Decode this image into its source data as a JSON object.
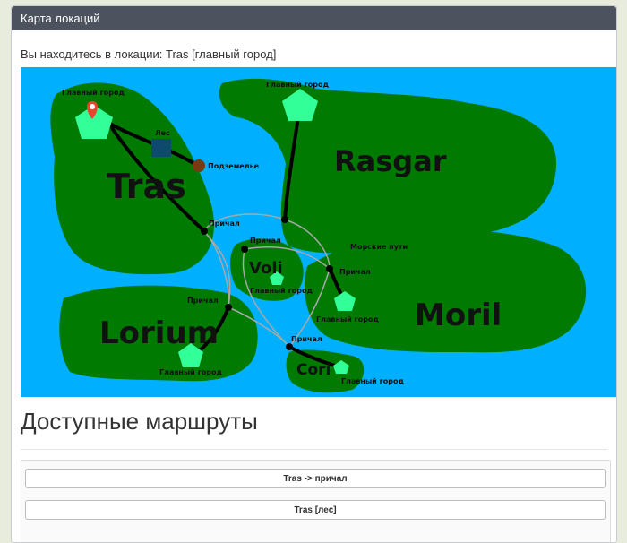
{
  "panel": {
    "title": "Карта локаций"
  },
  "location": {
    "current_text": "Вы находитесь в локации: Tras [главный город]"
  },
  "map": {
    "colors": {
      "sea": "#00b0ff",
      "land": "#007a00",
      "capital": "#33ff99",
      "forest": "#0e4a6e",
      "dungeon": "#7a3a10",
      "road": "#000000",
      "sea_route": "#a8a8a8"
    },
    "islands": [
      "Tras",
      "Rasgar",
      "Voli",
      "Moril",
      "Lorium",
      "Cori"
    ],
    "labels": {
      "capital_tras": "Главный город",
      "capital_rasgar": "Главный город",
      "capital_voli": "Главный город",
      "capital_moril": "Главный город",
      "capital_lorium": "Главный город",
      "capital_cori": "Главный город",
      "forest": "Лес",
      "dungeon": "Подземелье",
      "pier_tras": "Причал",
      "pier_voli": "Причал",
      "pier_moril": "Причал",
      "pier_lorium": "Причал",
      "pier_cori": "Причал",
      "sea_routes": "Морские пути"
    }
  },
  "routes": {
    "title": "Доступные маршруты",
    "buttons": [
      "Tras -> причал",
      "Tras [лес]"
    ]
  }
}
